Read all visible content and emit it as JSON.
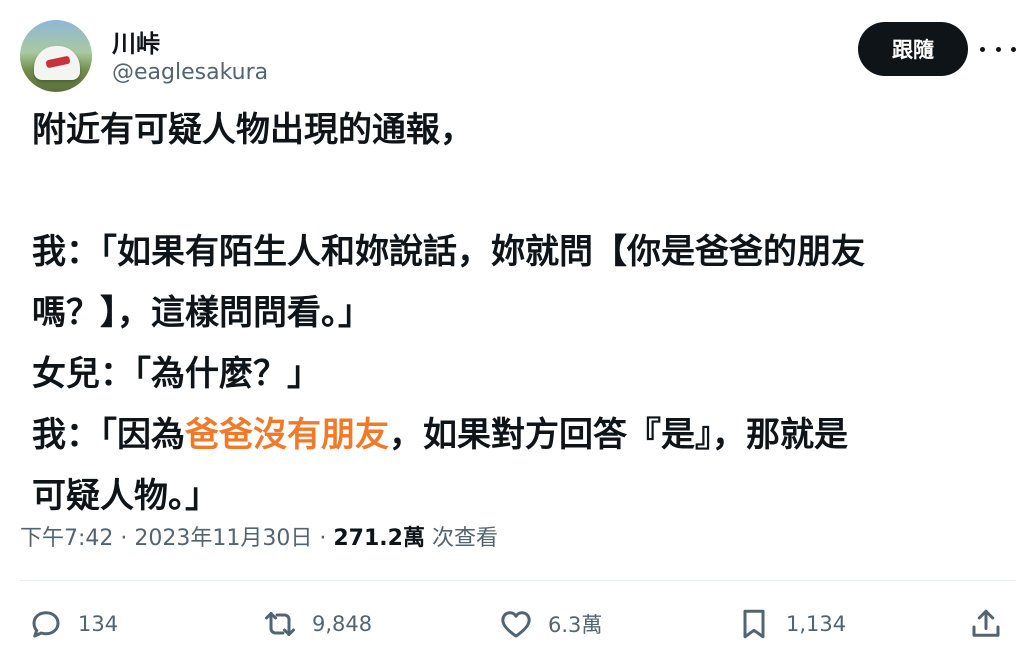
{
  "author": {
    "display_name": "川峠",
    "handle": "@eaglesakura"
  },
  "follow_label": "跟隨",
  "more_icon": "more-horizontal-icon",
  "tweet": {
    "line1": "附近有可疑人物出現的通報，",
    "line2": "我：「如果有陌生人和妳說話，妳就問【你是爸爸的朋友",
    "line3": "嗎？】，這樣問問看。」",
    "line4": "女兒：「為什麼？」",
    "line5_prefix": "我：「因為",
    "line5_highlight": "爸爸沒有朋友",
    "line5_suffix": "，如果對方回答『是』，那就是",
    "line6": "可疑人物。」",
    "highlight_color": "#f07a2a"
  },
  "meta": {
    "time": "下午7:42",
    "separator": " · ",
    "date": "2023年11月30日",
    "views_count": "271.2萬",
    "views_label": " 次查看"
  },
  "actions": {
    "reply_count": "134",
    "retweet_count": "9,848",
    "like_count": "6.3萬",
    "bookmark_count": "1,134"
  }
}
